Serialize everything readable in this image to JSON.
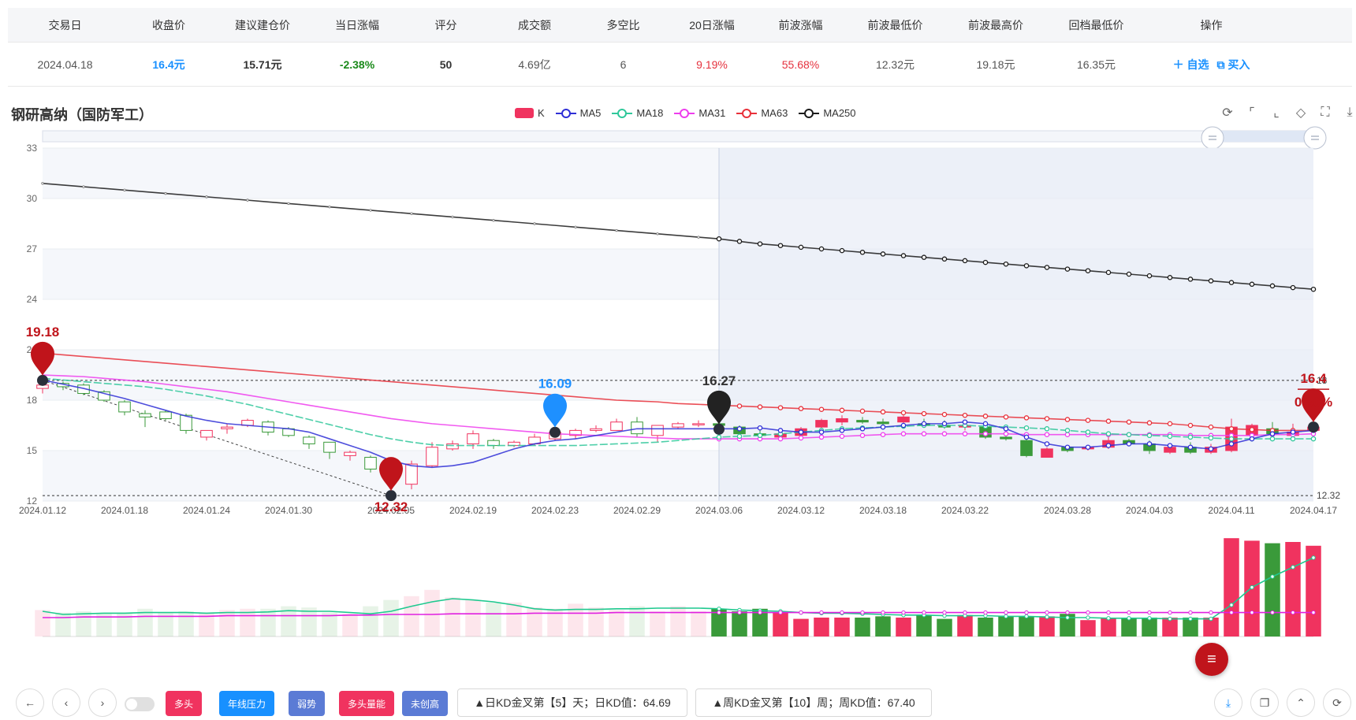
{
  "summary": {
    "headers": [
      "交易日",
      "收盘价",
      "建议建仓价",
      "当日涨幅",
      "评分",
      "成交额",
      "多空比",
      "20日涨幅",
      "前波涨幅",
      "前波最低价",
      "前波最高价",
      "回档最低价",
      "操作"
    ],
    "row": [
      "2024.04.18",
      "16.4元",
      "15.71元",
      "-2.38%",
      "50",
      "4.69亿",
      "6",
      "9.19%",
      "55.68%",
      "12.32元",
      "19.18元",
      "16.35元"
    ],
    "actions": [
      "＋ 自选",
      "⧉ 买入"
    ]
  },
  "chart_title": "钢研高纳（国防军工）",
  "colors": {
    "up": "#f0335f",
    "down": "#3a9a3a",
    "MA5": "#2f2fd6",
    "MA18": "#2fc79a",
    "MA31": "#ee3ded",
    "MA63": "#e8303a",
    "MA250": "#1a1a1a",
    "pin_red": "#c0141b",
    "pin_blue": "#1e90ff",
    "pin_black": "#222222"
  },
  "toolbox_icons": [
    "refresh-icon",
    "crop-icon",
    "crop-reset-icon",
    "restore-icon",
    "fullscreen-icon",
    "download-icon"
  ],
  "chart_data": {
    "type": "candlestick",
    "legend": [
      "K",
      "MA5",
      "MA18",
      "MA31",
      "MA63",
      "MA250"
    ],
    "legend_position": "top-center",
    "y_ticks": [
      "33",
      "30",
      "27",
      "24",
      "21",
      "18",
      "15",
      "12"
    ],
    "ylim": [
      12,
      33
    ],
    "x_ticks": [
      "2024.01.12",
      "2024.01.18",
      "2024.01.24",
      "2024.01.30",
      "2024.02.05",
      "2024.02.19",
      "2024.02.23",
      "2024.02.29",
      "2024.03.06",
      "2024.03.12",
      "2024.03.18",
      "2024.03.22",
      "2024.03.28",
      "2024.04.03",
      "2024.04.11",
      "2024.04.17"
    ],
    "ohlc": [
      [
        18.7,
        19.18,
        18.4,
        18.9
      ],
      [
        19.0,
        19.1,
        18.6,
        18.8
      ],
      [
        18.9,
        19.0,
        18.3,
        18.4
      ],
      [
        18.5,
        18.6,
        17.9,
        18.0
      ],
      [
        17.9,
        18.0,
        17.1,
        17.3
      ],
      [
        17.2,
        17.4,
        16.4,
        17.0
      ],
      [
        17.3,
        17.4,
        16.8,
        16.9
      ],
      [
        17.1,
        17.2,
        16.0,
        16.2
      ],
      [
        15.8,
        16.2,
        15.6,
        16.2
      ],
      [
        16.3,
        16.6,
        16.0,
        16.4
      ],
      [
        16.5,
        16.9,
        16.4,
        16.8
      ],
      [
        16.7,
        16.8,
        15.9,
        16.1
      ],
      [
        16.3,
        16.4,
        15.8,
        15.9
      ],
      [
        15.8,
        15.9,
        15.1,
        15.4
      ],
      [
        15.5,
        15.5,
        14.5,
        14.9
      ],
      [
        14.7,
        15.0,
        14.4,
        14.9
      ],
      [
        14.6,
        14.7,
        13.7,
        13.9
      ],
      [
        13.8,
        14.0,
        12.32,
        13.2
      ],
      [
        13.0,
        14.4,
        12.7,
        14.2
      ],
      [
        14.1,
        15.5,
        14.0,
        15.2
      ],
      [
        15.1,
        15.6,
        15.0,
        15.4
      ],
      [
        15.4,
        16.2,
        15.1,
        16.0
      ],
      [
        15.6,
        15.7,
        15.1,
        15.3
      ],
      [
        15.3,
        15.6,
        15.2,
        15.5
      ],
      [
        15.4,
        16.0,
        15.3,
        15.8
      ],
      [
        15.7,
        16.1,
        15.6,
        16.1
      ],
      [
        15.9,
        16.3,
        15.7,
        16.2
      ],
      [
        16.2,
        16.5,
        16.1,
        16.3
      ],
      [
        16.2,
        16.9,
        16.2,
        16.7
      ],
      [
        16.7,
        17.0,
        15.8,
        16.0
      ],
      [
        15.9,
        16.5,
        15.5,
        16.5
      ],
      [
        16.4,
        16.7,
        16.3,
        16.6
      ],
      [
        16.6,
        16.8,
        16.4,
        16.6
      ],
      [
        16.6,
        16.7,
        16.4,
        16.5
      ],
      [
        16.4,
        16.5,
        15.9,
        16.0
      ],
      [
        16.0,
        16.4,
        15.7,
        15.9
      ],
      [
        15.8,
        16.1,
        15.7,
        16.0
      ],
      [
        15.9,
        16.4,
        15.8,
        16.3
      ],
      [
        16.4,
        16.9,
        16.3,
        16.8
      ],
      [
        16.7,
        17.1,
        16.5,
        16.9
      ],
      [
        16.8,
        17.0,
        16.6,
        16.7
      ],
      [
        16.7,
        16.9,
        16.5,
        16.6
      ],
      [
        16.7,
        17.1,
        16.6,
        17.0
      ],
      [
        16.6,
        16.9,
        16.4,
        16.5
      ],
      [
        16.5,
        16.8,
        16.3,
        16.4
      ],
      [
        16.4,
        16.6,
        16.2,
        16.5
      ],
      [
        16.4,
        16.6,
        15.7,
        15.8
      ],
      [
        15.8,
        15.9,
        15.6,
        15.7
      ],
      [
        15.6,
        15.7,
        14.6,
        14.7
      ],
      [
        14.6,
        15.2,
        14.6,
        15.1
      ],
      [
        15.2,
        15.3,
        14.9,
        15.0
      ],
      [
        15.1,
        15.3,
        15.0,
        15.2
      ],
      [
        15.2,
        15.8,
        15.1,
        15.6
      ],
      [
        15.6,
        15.7,
        15.3,
        15.4
      ],
      [
        15.4,
        15.6,
        14.8,
        15.0
      ],
      [
        14.9,
        15.4,
        14.8,
        15.2
      ],
      [
        15.2,
        15.5,
        14.8,
        14.9
      ],
      [
        14.9,
        15.4,
        14.8,
        15.2
      ],
      [
        15.0,
        16.9,
        14.9,
        16.4
      ],
      [
        15.9,
        16.6,
        15.7,
        16.5
      ],
      [
        16.3,
        16.7,
        15.9,
        16.0
      ],
      [
        15.9,
        16.6,
        15.8,
        16.1
      ],
      [
        16.2,
        16.4,
        15.9,
        16.4
      ]
    ],
    "ma5": [
      19.2,
      18.95,
      18.7,
      18.4,
      18.1,
      17.75,
      17.4,
      17.05,
      16.8,
      16.6,
      16.5,
      16.4,
      16.3,
      16.1,
      15.7,
      15.3,
      14.9,
      14.4,
      14.1,
      14.0,
      14.1,
      14.3,
      14.7,
      15.1,
      15.4,
      15.6,
      15.7,
      15.9,
      16.1,
      16.3,
      16.3,
      16.3,
      16.3,
      16.3,
      16.3,
      16.35,
      16.2,
      16.1,
      16.1,
      16.2,
      16.3,
      16.4,
      16.5,
      16.6,
      16.6,
      16.7,
      16.6,
      16.3,
      15.8,
      15.4,
      15.2,
      15.2,
      15.3,
      15.4,
      15.4,
      15.3,
      15.2,
      15.1,
      15.4,
      15.7,
      16.0,
      16.1,
      16.2
    ],
    "ma18": [
      19.3,
      19.2,
      19.1,
      19.0,
      18.9,
      18.8,
      18.65,
      18.45,
      18.25,
      18.0,
      17.75,
      17.45,
      17.15,
      16.85,
      16.55,
      16.25,
      15.95,
      15.7,
      15.5,
      15.35,
      15.3,
      15.3,
      15.3,
      15.3,
      15.3,
      15.3,
      15.3,
      15.35,
      15.4,
      15.45,
      15.5,
      15.6,
      15.7,
      15.8,
      15.85,
      15.9,
      16.0,
      16.1,
      16.2,
      16.3,
      16.35,
      16.4,
      16.45,
      16.5,
      16.5,
      16.5,
      16.45,
      16.4,
      16.35,
      16.3,
      16.2,
      16.1,
      16.0,
      15.95,
      15.9,
      15.85,
      15.8,
      15.75,
      15.7,
      15.7,
      15.7,
      15.7,
      15.7
    ],
    "ma31": [
      19.5,
      19.45,
      19.4,
      19.3,
      19.2,
      19.1,
      18.95,
      18.8,
      18.65,
      18.5,
      18.3,
      18.1,
      17.9,
      17.7,
      17.5,
      17.3,
      17.1,
      16.9,
      16.75,
      16.6,
      16.5,
      16.4,
      16.3,
      16.2,
      16.1,
      16.0,
      15.95,
      15.9,
      15.85,
      15.8,
      15.75,
      15.7,
      15.7,
      15.7,
      15.7,
      15.7,
      15.7,
      15.75,
      15.8,
      15.85,
      15.9,
      15.95,
      16.0,
      16.0,
      16.0,
      16.0,
      16.0,
      16.0,
      15.95,
      15.95,
      15.95,
      15.95,
      15.95,
      15.95,
      15.95,
      15.95,
      15.9,
      15.9,
      15.9,
      15.9,
      15.95,
      15.95,
      16.0
    ],
    "ma63": [
      20.8,
      20.7,
      20.6,
      20.5,
      20.4,
      20.3,
      20.2,
      20.1,
      20.0,
      19.9,
      19.8,
      19.7,
      19.6,
      19.5,
      19.4,
      19.3,
      19.2,
      19.1,
      19.0,
      18.9,
      18.8,
      18.7,
      18.6,
      18.5,
      18.4,
      18.3,
      18.2,
      18.1,
      18.0,
      17.95,
      17.9,
      17.8,
      17.75,
      17.7,
      17.65,
      17.6,
      17.55,
      17.5,
      17.45,
      17.4,
      17.35,
      17.3,
      17.25,
      17.2,
      17.15,
      17.1,
      17.05,
      17.0,
      16.95,
      16.9,
      16.85,
      16.8,
      16.75,
      16.7,
      16.65,
      16.6,
      16.5,
      16.4,
      16.3,
      16.25,
      16.2,
      16.2,
      16.2
    ],
    "ma250": [
      30.9,
      30.8,
      30.7,
      30.6,
      30.5,
      30.4,
      30.3,
      30.2,
      30.1,
      30.0,
      29.9,
      29.8,
      29.7,
      29.6,
      29.5,
      29.4,
      29.3,
      29.2,
      29.1,
      29.0,
      28.9,
      28.8,
      28.7,
      28.6,
      28.5,
      28.4,
      28.3,
      28.2,
      28.1,
      28.0,
      27.9,
      27.8,
      27.7,
      27.6,
      27.45,
      27.3,
      27.2,
      27.1,
      27.0,
      26.9,
      26.8,
      26.7,
      26.6,
      26.5,
      26.4,
      26.3,
      26.2,
      26.1,
      26.0,
      25.9,
      25.8,
      25.7,
      25.6,
      25.5,
      25.4,
      25.3,
      25.2,
      25.1,
      25.0,
      24.9,
      24.8,
      24.7,
      24.6
    ],
    "volume": [
      42,
      38,
      40,
      36,
      38,
      44,
      38,
      40,
      38,
      42,
      44,
      44,
      48,
      46,
      38,
      36,
      48,
      58,
      64,
      74,
      62,
      58,
      54,
      54,
      46,
      44,
      52,
      46,
      42,
      48,
      40,
      48,
      40,
      44,
      40,
      44,
      38,
      28,
      30,
      30,
      30,
      32,
      30,
      34,
      28,
      34,
      30,
      32,
      32,
      32,
      36,
      26,
      30,
      30,
      30,
      30,
      30,
      30,
      156,
      152,
      148,
      150,
      144
    ],
    "vol_ma_green": [
      40,
      35,
      36,
      37,
      37,
      38,
      38,
      38,
      37,
      38,
      38,
      39,
      41,
      40,
      40,
      38,
      36,
      40,
      48,
      55,
      60,
      58,
      55,
      50,
      44,
      42,
      43,
      43,
      44,
      44,
      45,
      45,
      45,
      44,
      42,
      41,
      40,
      38,
      37,
      37,
      36,
      35,
      34,
      34,
      33,
      33,
      33,
      32,
      32,
      31,
      30,
      30,
      29,
      29,
      29,
      28,
      28,
      28,
      50,
      78,
      95,
      110,
      125
    ],
    "vol_ma_magenta": [
      30,
      30,
      31,
      31,
      31,
      32,
      32,
      32,
      32,
      33,
      33,
      33,
      33,
      33,
      33,
      34,
      34,
      35,
      35,
      35,
      36,
      36,
      36,
      36,
      37,
      37,
      37,
      37,
      38,
      38,
      38,
      38,
      38,
      38,
      38,
      38,
      38,
      38,
      38,
      38,
      38,
      38,
      38,
      38,
      38,
      38,
      38,
      38,
      38,
      38,
      38,
      38,
      38,
      38,
      38,
      38,
      38,
      38,
      38,
      38,
      38,
      38,
      38
    ],
    "highlight_start_index": 33,
    "ref_lines": [
      {
        "value": 19.18,
        "label": "18"
      },
      {
        "value": 12.32,
        "label": "12.32"
      }
    ],
    "pins": [
      {
        "index": 0,
        "value": 19.18,
        "label": "19.18",
        "color": "pin_red"
      },
      {
        "index": 17,
        "value": 12.32,
        "label": "12.32",
        "color": "pin_red"
      },
      {
        "index": 25,
        "value": 16.09,
        "label": "16.09",
        "color": "pin_blue"
      },
      {
        "index": 33,
        "value": 16.27,
        "label": "16.27",
        "color": "pin_black"
      },
      {
        "index": 62,
        "value": 16.4,
        "label": "16.4",
        "sublabel": "0.80%",
        "color": "pin_red"
      }
    ]
  },
  "bottom": {
    "nav_icons": [
      "back-icon",
      "prev-icon",
      "next-icon"
    ],
    "tags": [
      {
        "label": "多头",
        "color": "#f0335f"
      },
      {
        "label": "年线压力",
        "color": "#1890ff"
      },
      {
        "label": "弱势",
        "color": "#5b7bd5"
      },
      {
        "label": "多头量能",
        "color": "#f0335f"
      },
      {
        "label": "未创高",
        "color": "#5b7bd5"
      }
    ],
    "kd_day": "▲日KD金叉第【5】天；日KD值：64.69",
    "kd_week": "▲周KD金叉第【10】周；周KD值：67.40",
    "right_icons": [
      "download-icon",
      "copy-icon",
      "scroll-top-icon",
      "refresh-icon"
    ],
    "fab_icon": "menu-icon"
  }
}
